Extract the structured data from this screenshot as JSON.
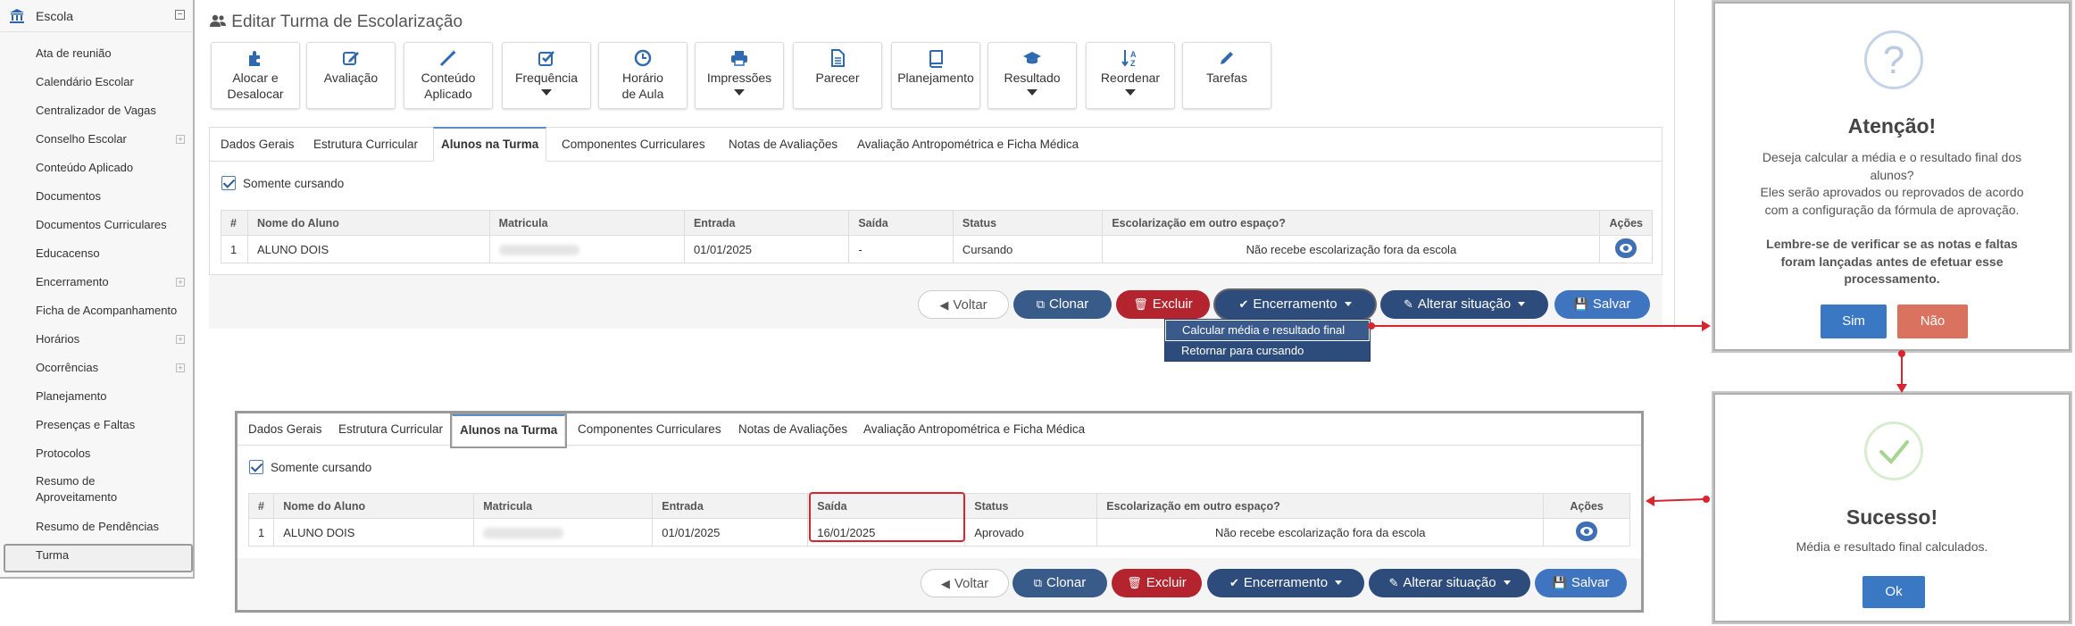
{
  "sidebar": {
    "header": "Escola",
    "toggle": "⊟",
    "items": [
      {
        "label": "Ata de reunião",
        "expandable": false
      },
      {
        "label": "Calendário Escolar",
        "expandable": false
      },
      {
        "label": "Centralizador de Vagas",
        "expandable": false
      },
      {
        "label": "Conselho Escolar",
        "expandable": true
      },
      {
        "label": "Conteúdo Aplicado",
        "expandable": false
      },
      {
        "label": "Documentos",
        "expandable": false
      },
      {
        "label": "Documentos Curriculares",
        "expandable": false
      },
      {
        "label": "Educacenso",
        "expandable": false
      },
      {
        "label": "Encerramento",
        "expandable": true
      },
      {
        "label": "Ficha de Acompanhamento",
        "expandable": false
      },
      {
        "label": "Horários",
        "expandable": true
      },
      {
        "label": "Ocorrências",
        "expandable": true
      },
      {
        "label": "Planejamento",
        "expandable": false
      },
      {
        "label": "Presenças e Faltas",
        "expandable": false
      },
      {
        "label": "Protocolos",
        "expandable": false
      },
      {
        "label": "Resumo de Aproveitamento",
        "expandable": false
      },
      {
        "label": "Resumo de Pendências",
        "expandable": false
      },
      {
        "label": "Turma",
        "expandable": false
      }
    ]
  },
  "page": {
    "title": "Editar Turma de Escolarização"
  },
  "toolbar": [
    {
      "label": "Alocar e Desalocar",
      "icon": "puzzle-icon",
      "caret": false
    },
    {
      "label": "Avaliação",
      "icon": "edit-icon",
      "caret": false
    },
    {
      "label": "Conteúdo Aplicado",
      "icon": "magic-wand-icon",
      "caret": false
    },
    {
      "label": "Frequência",
      "icon": "checkbox-icon",
      "caret": true
    },
    {
      "label": "Horário de Aula",
      "icon": "clock-icon",
      "caret": false
    },
    {
      "label": "Impressões",
      "icon": "printer-icon",
      "caret": true
    },
    {
      "label": "Parecer",
      "icon": "document-icon",
      "caret": false
    },
    {
      "label": "Planejamento",
      "icon": "book-icon",
      "caret": false
    },
    {
      "label": "Resultado",
      "icon": "graduation-cap-icon",
      "caret": true
    },
    {
      "label": "Reordenar",
      "icon": "sort-alpha-icon",
      "caret": true
    },
    {
      "label": "Tarefas",
      "icon": "pencil-icon",
      "caret": false
    }
  ],
  "tabs": [
    "Dados Gerais",
    "Estrutura Curricular",
    "Alunos na Turma",
    "Componentes Curriculares",
    "Notas de Avaliações",
    "Avaliação Antropométrica e Ficha Médica"
  ],
  "filter": {
    "label": "Somente cursando",
    "checked": true
  },
  "table": {
    "headers": [
      "#",
      "Nome do Aluno",
      "Matricula",
      "Entrada",
      "Saída",
      "Status",
      "Escolarização em outro espaço?",
      "Ações"
    ]
  },
  "before": {
    "row": {
      "num": "1",
      "name": "ALUNO DOIS",
      "entrada": "01/01/2025",
      "saida": "-",
      "status": "Cursando",
      "outro": "Não recebe escolarização fora da escola"
    }
  },
  "after": {
    "row": {
      "num": "1",
      "name": "ALUNO DOIS",
      "entrada": "01/01/2025",
      "saida": "16/01/2025",
      "status": "Aprovado",
      "outro": "Não recebe escolarização fora da escola"
    }
  },
  "actions": {
    "voltar": "Voltar",
    "clonar": "Clonar",
    "excluir": "Excluir",
    "encerramento": "Encerramento",
    "alterar": "Alterar situação",
    "salvar": "Salvar"
  },
  "dropdown": [
    "Calcular média e resultado final",
    "Retornar para cursando"
  ],
  "confirm_modal": {
    "icon": "?",
    "title": "Atenção!",
    "line1": "Deseja calcular a média e o resultado final dos",
    "line2": "alunos?",
    "line3": "Eles serão aprovados ou reprovados de acordo",
    "line4": "com a configuração da fórmula de aprovação.",
    "bold1": "Lembre-se de verificar se as notas e faltas",
    "bold2": "foram lançadas antes de efetuar esse",
    "bold3": "processamento.",
    "yes": "Sim",
    "no": "Não"
  },
  "success_modal": {
    "title": "Sucesso!",
    "message": "Média e resultado final calculados.",
    "ok": "Ok"
  },
  "colors": {
    "primary": "#3f74c0",
    "danger": "#b3242f",
    "accent": "#d9262e",
    "no_button": "#d9735f",
    "sim_button": "#3b78c4"
  }
}
